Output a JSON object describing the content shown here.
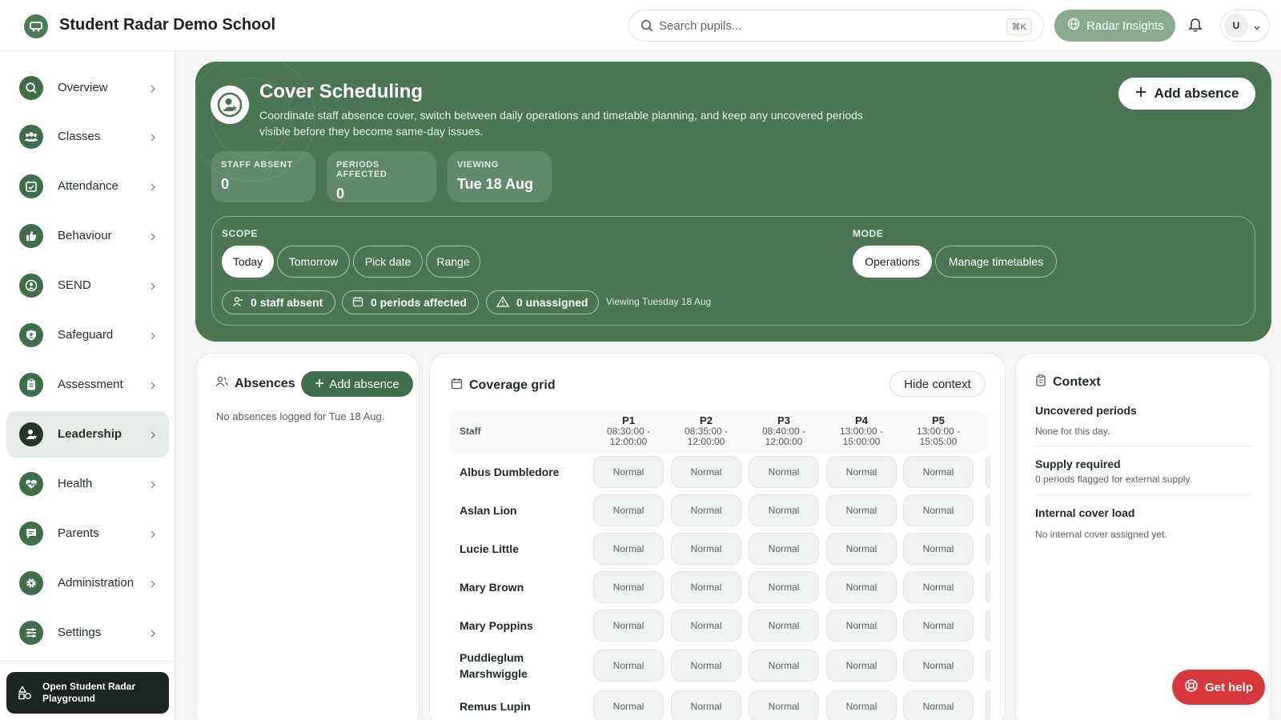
{
  "header": {
    "app_title": "Student Radar Demo School",
    "search_placeholder": "Search pupils...",
    "search_shortcut": "⌘K",
    "insights_label": "Radar Insights",
    "user_initial": "U"
  },
  "sidebar": {
    "items": [
      {
        "label": "Overview",
        "icon": "search-icon"
      },
      {
        "label": "Classes",
        "icon": "group-icon"
      },
      {
        "label": "Attendance",
        "icon": "calendar-check-icon"
      },
      {
        "label": "Behaviour",
        "icon": "thumbs-up-icon"
      },
      {
        "label": "SEND",
        "icon": "person-circle-icon"
      },
      {
        "label": "Safeguard",
        "icon": "shield-icon"
      },
      {
        "label": "Assessment",
        "icon": "clipboard-icon"
      },
      {
        "label": "Leadership",
        "icon": "person-star-icon",
        "active": true
      },
      {
        "label": "Health",
        "icon": "heart-pulse-icon"
      },
      {
        "label": "Parents",
        "icon": "chat-icon"
      },
      {
        "label": "Administration",
        "icon": "gear-icon"
      },
      {
        "label": "Settings",
        "icon": "sliders-icon"
      }
    ],
    "playground_label": "Open Student Radar Playground"
  },
  "hero": {
    "title": "Cover Scheduling",
    "description": "Coordinate staff absence cover, switch between daily operations and timetable planning, and keep any uncovered periods visible before they become same-day issues.",
    "add_absence_label": "Add absence",
    "stats": [
      {
        "label": "STAFF ABSENT",
        "value": "0"
      },
      {
        "label": "PERIODS AFFECTED",
        "value": "0"
      },
      {
        "label": "VIEWING",
        "value": "Tue 18 Aug"
      }
    ],
    "scope_label": "SCOPE",
    "scope_options": [
      "Today",
      "Tomorrow",
      "Pick date",
      "Range"
    ],
    "scope_selected": "Today",
    "mode_label": "MODE",
    "mode_options": [
      "Operations",
      "Manage timetables"
    ],
    "mode_selected": "Operations",
    "chips": [
      "0 staff absent",
      "0 periods affected",
      "0 unassigned"
    ],
    "viewing_note": "Viewing Tuesday 18 Aug"
  },
  "absences": {
    "title": "Absences",
    "add_label": "Add absence",
    "empty_text": "No absences logged for Tue 18 Aug."
  },
  "coverage": {
    "title": "Coverage grid",
    "hide_context_label": "Hide context",
    "staff_header": "Staff",
    "periods": [
      {
        "name": "P1",
        "start": "08:30:00 -",
        "end": "12:00:00"
      },
      {
        "name": "P2",
        "start": "08:35:00 -",
        "end": "12:00:00"
      },
      {
        "name": "P3",
        "start": "08:40:00 -",
        "end": "12:00:00"
      },
      {
        "name": "P4",
        "start": "13:00:00 -",
        "end": "15:00:00"
      },
      {
        "name": "P5",
        "start": "13:00:00 -",
        "end": "15:05:00"
      }
    ],
    "rows": [
      {
        "staff": "Albus Dumbledore",
        "cells": [
          "Normal",
          "Normal",
          "Normal",
          "Normal",
          "Normal"
        ]
      },
      {
        "staff": "Aslan Lion",
        "cells": [
          "Normal",
          "Normal",
          "Normal",
          "Normal",
          "Normal"
        ]
      },
      {
        "staff": "Lucie Little",
        "cells": [
          "Normal",
          "Normal",
          "Normal",
          "Normal",
          "Normal"
        ]
      },
      {
        "staff": "Mary Brown",
        "cells": [
          "Normal",
          "Normal",
          "Normal",
          "Normal",
          "Normal"
        ]
      },
      {
        "staff": "Mary Poppins",
        "cells": [
          "Normal",
          "Normal",
          "Normal",
          "Normal",
          "Normal"
        ]
      },
      {
        "staff": "Puddleglum Marshwiggle",
        "cells": [
          "Normal",
          "Normal",
          "Normal",
          "Normal",
          "Normal"
        ]
      },
      {
        "staff": "Remus Lupin",
        "cells": [
          "Normal",
          "Normal",
          "Normal",
          "Normal",
          "Normal"
        ]
      }
    ]
  },
  "context": {
    "title": "Context",
    "sections": [
      {
        "title": "Uncovered periods",
        "text": "None for this day."
      },
      {
        "title": "Supply required",
        "text": "0 periods flagged for external supply."
      },
      {
        "title": "Internal cover load",
        "text": "No internal cover assigned yet."
      }
    ]
  },
  "help_label": "Get help",
  "colors": {
    "accent": "#4a7653",
    "nav_icon": "#3f6e4d",
    "help": "#d8373c"
  }
}
